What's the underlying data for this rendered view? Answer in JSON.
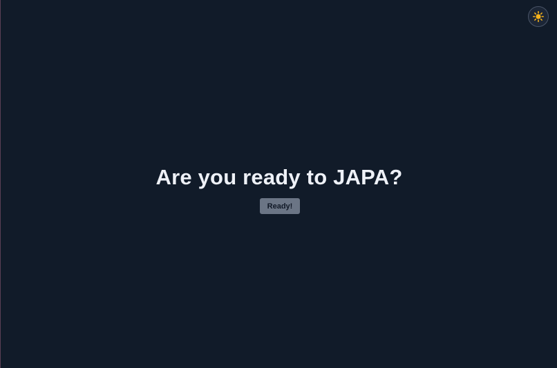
{
  "theme_toggle": {
    "icon": "sun-icon",
    "sun_color": "#f6b21b",
    "background": "#1c2636"
  },
  "hero": {
    "title": "Are you ready to JAPA?"
  },
  "actions": {
    "ready_label": "Ready!"
  },
  "colors": {
    "page_background": "#111b29",
    "title_text": "#eef1f7",
    "button_background": "#6b7585",
    "button_text": "#101826"
  }
}
